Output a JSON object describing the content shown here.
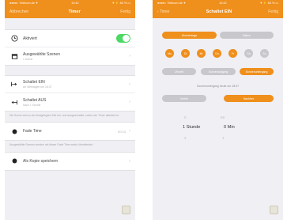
{
  "screen1": {
    "status": {
      "carrier": "●●●●○ Telekom.de ✈",
      "time": "10:42",
      "battery": "✈ ⚡ 83 % ▭"
    },
    "nav": {
      "back": "Abbrechen",
      "title": "Timer",
      "done": "Fertig"
    },
    "rows": {
      "active": {
        "label": "Aktiviert",
        "icon": "clock-icon"
      },
      "scenes": {
        "label": "Ausgewählte Szenen",
        "sub": "1 Szene",
        "icon": "scene-icon"
      },
      "on": {
        "label": "Schaltet EIN",
        "sub": "An Werktagen um 16:37",
        "icon": "switch-on-icon"
      },
      "off": {
        "label": "Schaltet AUS",
        "sub": "Nach 1 Stunde"
      },
      "fade": {
        "label": "Fade Time",
        "value": "00:03"
      },
      "copy": {
        "label": "Als Kopie speichern"
      }
    },
    "notes": {
      "n1": "Die Szene wird zu der festgelegten Zeit ein- und ausgeschaltet, sofern der Timer aktiviert ist.",
      "n2": "Ausgewählte Szenen werden mit dieser Fade Time weich überblendet."
    }
  },
  "screen2": {
    "status": {
      "carrier": "●●●●○ Telekom.de ✈",
      "time": "10:42",
      "battery": "✈ ⚡ 83 % ▭"
    },
    "nav": {
      "back": "Timer",
      "title": "Schaltet EIN",
      "done": "Fertig"
    },
    "segments": {
      "left": "Wochentage",
      "right": "Datum"
    },
    "days": [
      "Mo",
      "Di",
      "Mi",
      "Do",
      "Fr",
      "Sa",
      "So"
    ],
    "modes": {
      "a": "Uhrzeit",
      "b": "Sonnenaufgang",
      "c": "Sonnenuntergang"
    },
    "info": "Sonnenuntergang heute um 18:37",
    "offset": {
      "before": "Vorher",
      "after": "Nachher"
    },
    "picker": {
      "prev_h": "0",
      "hour": "1 Stunde",
      "next_h": "2",
      "prev_m": "59",
      "min": "0 Min",
      "next_m": "1"
    }
  },
  "colors": {
    "accent": "#ef8f1c",
    "accent_dim": "#f5b668",
    "gray_seg": "#c8c8cc",
    "toggle_on": "#4cd964"
  }
}
